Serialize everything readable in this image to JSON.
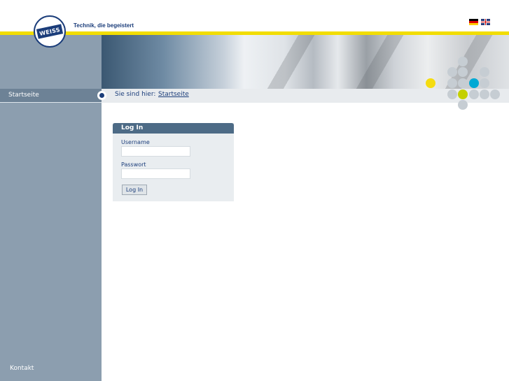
{
  "header": {
    "logo_text": "WEISS",
    "tagline": "Technik, die begeistert",
    "languages": [
      "de-flag-icon",
      "gb-flag-icon"
    ]
  },
  "sidebar": {
    "items": [
      {
        "label": "Startseite"
      }
    ],
    "footer_link": "Kontakt"
  },
  "breadcrumb": {
    "prefix": "Sie sind hier:",
    "current": "Startseite"
  },
  "login": {
    "title": "Log In",
    "username_label": "Username",
    "username_value": "",
    "password_label": "Passwort",
    "password_value": "",
    "submit_label": "Log In"
  },
  "colors": {
    "brand_blue": "#1b3d7a",
    "accent_yellow": "#f2dd00",
    "sidebar": "#8c9eaf",
    "panel_header": "#4d6b86",
    "dot_grey": "#c6cdd3",
    "dot_yellow": "#f5dc10",
    "dot_lime": "#c4d000",
    "dot_cyan": "#00a9d4"
  }
}
